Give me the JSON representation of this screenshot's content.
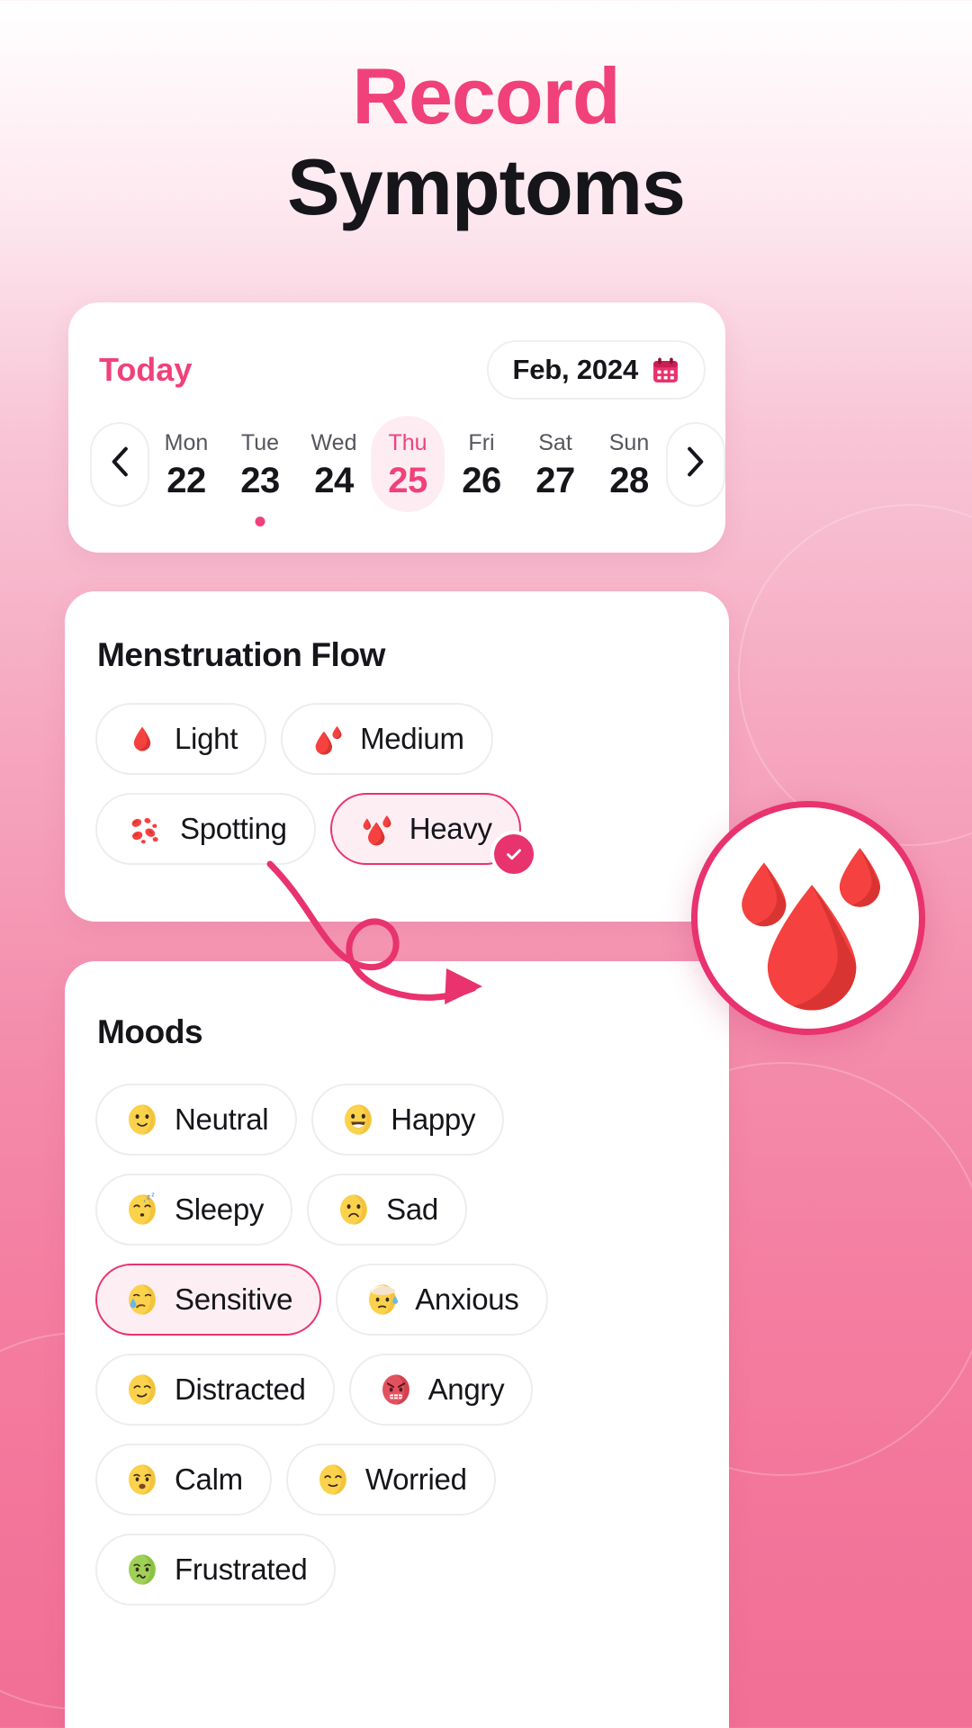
{
  "header": {
    "title_line1": "Record",
    "title_line2": "Symptoms",
    "accent_color": "#F0417A",
    "dark_color": "#15151A"
  },
  "date_card": {
    "today_label": "Today",
    "month_value": "Feb, 2024",
    "calendar_icon": "calendar-icon",
    "prev_icon": "chevron-left-icon",
    "next_icon": "chevron-right-icon",
    "days": [
      {
        "dow": "Mon",
        "num": "22",
        "selected": false,
        "dot": false
      },
      {
        "dow": "Tue",
        "num": "23",
        "selected": false,
        "dot": true
      },
      {
        "dow": "Wed",
        "num": "24",
        "selected": false,
        "dot": false
      },
      {
        "dow": "Thu",
        "num": "25",
        "selected": true,
        "dot": false
      },
      {
        "dow": "Fri",
        "num": "26",
        "selected": false,
        "dot": false
      },
      {
        "dow": "Sat",
        "num": "27",
        "selected": false,
        "dot": false
      },
      {
        "dow": "Sun",
        "num": "28",
        "selected": false,
        "dot": false
      }
    ]
  },
  "flow_section": {
    "title": "Menstruation Flow",
    "options": [
      {
        "label": "Light",
        "icon": "blood-drop-icon",
        "selected": false
      },
      {
        "label": "Medium",
        "icon": "blood-drops-two-icon",
        "selected": false
      },
      {
        "label": "Spotting",
        "icon": "blood-spots-icon",
        "selected": false
      },
      {
        "label": "Heavy",
        "icon": "blood-drops-three-icon",
        "selected": true
      }
    ],
    "selected_badge_icon": "check-icon",
    "selected_color": "#E8336E",
    "selected_fill": "#FDEEF3",
    "blood_color": "#F5413F"
  },
  "callout": {
    "icon": "blood-drops-three-icon",
    "ring_color": "#E8336E",
    "arrow_icon": "curved-arrow-icon"
  },
  "moods_section": {
    "title": "Moods",
    "options": [
      {
        "label": "Neutral",
        "icon": "neutral-face-emoji",
        "selected": false
      },
      {
        "label": "Happy",
        "icon": "happy-face-emoji",
        "selected": false
      },
      {
        "label": "Sleepy",
        "icon": "sleepy-face-emoji",
        "selected": false
      },
      {
        "label": "Sad",
        "icon": "sad-face-emoji",
        "selected": false
      },
      {
        "label": "Sensitive",
        "icon": "crying-face-emoji",
        "selected": true
      },
      {
        "label": "Anxious",
        "icon": "anxious-sweat-emoji",
        "selected": false
      },
      {
        "label": "Distracted",
        "icon": "smirking-face-emoji",
        "selected": false
      },
      {
        "label": "Angry",
        "icon": "angry-face-emoji",
        "selected": false
      },
      {
        "label": "Calm",
        "icon": "worried-face-emoji",
        "selected": false
      },
      {
        "label": "Worried",
        "icon": "relieved-face-emoji",
        "selected": false
      },
      {
        "label": "Frustrated",
        "icon": "nauseated-face-emoji",
        "selected": false
      }
    ]
  }
}
